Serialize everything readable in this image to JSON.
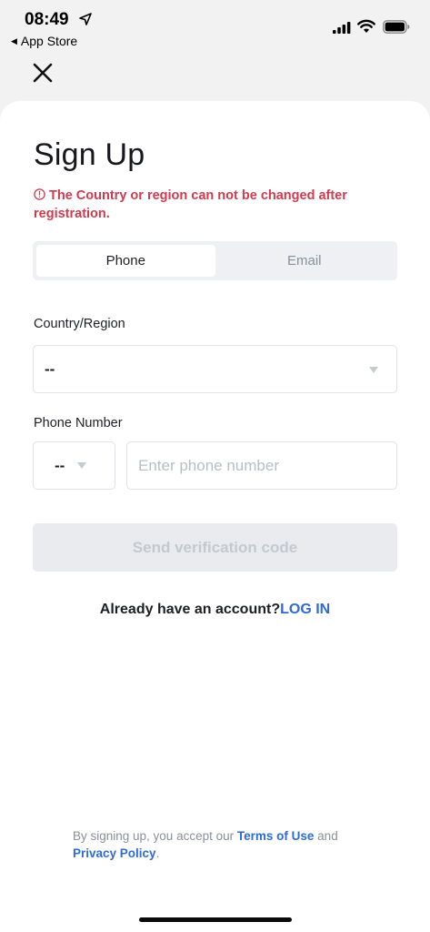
{
  "status_bar": {
    "time": "08:49",
    "back_app": "App Store"
  },
  "header": {
    "title": "Sign Up",
    "warning": "The Country or region can not be changed after registration."
  },
  "tabs": [
    {
      "label": "Phone",
      "active": true
    },
    {
      "label": "Email",
      "active": false
    }
  ],
  "form": {
    "country_label": "Country/Region",
    "country_value": "--",
    "phone_label": "Phone Number",
    "phone_code_value": "--",
    "phone_placeholder": "Enter phone number",
    "send_button": "Send verification code"
  },
  "account": {
    "prompt": "Already have an account?",
    "login_link": "LOG IN"
  },
  "terms": {
    "prefix": "By signing up, you accept our",
    "terms_link": "Terms of Use",
    "and": "and",
    "privacy_link": "Privacy Policy",
    "suffix": "."
  },
  "colors": {
    "accent": "#2f6bd8",
    "warning": "#cf3b4f"
  }
}
